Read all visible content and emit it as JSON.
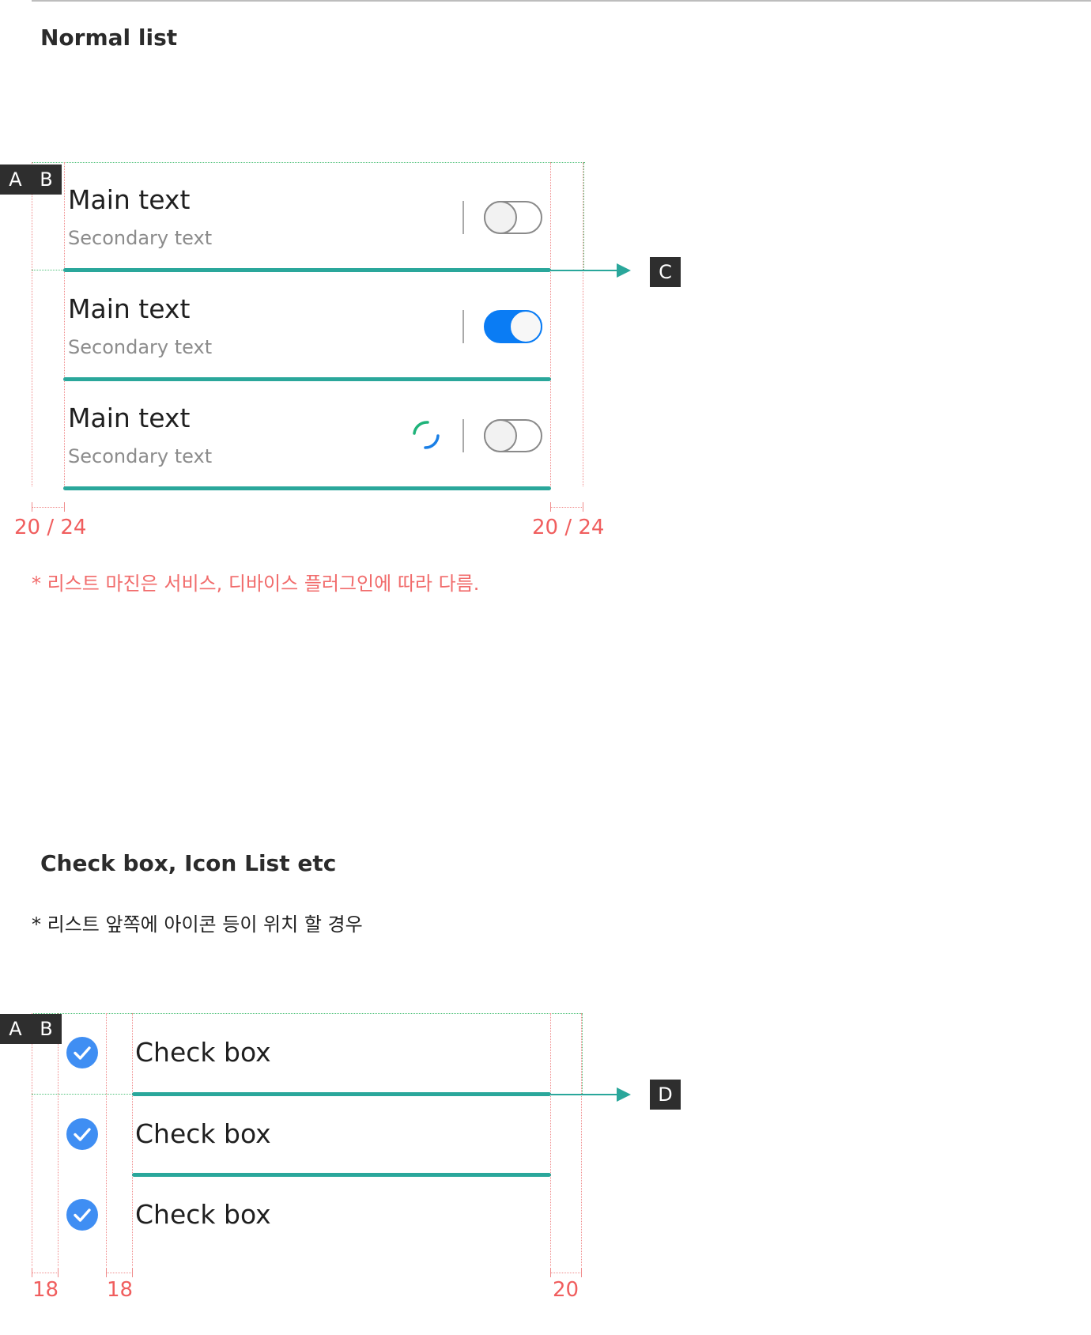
{
  "section1": {
    "title": "Normal list",
    "rows": [
      {
        "main": "Main text",
        "secondary": "Secondary text",
        "toggle": "off",
        "loading": false
      },
      {
        "main": "Main text",
        "secondary": "Secondary text",
        "toggle": "on",
        "loading": false
      },
      {
        "main": "Main text",
        "secondary": "Secondary text",
        "toggle": "off",
        "loading": true
      }
    ],
    "markers": {
      "a": "A",
      "b": "B",
      "c": "C"
    },
    "dim_left": "20 / 24",
    "dim_right": "20 / 24",
    "note": "* 리스트 마진은 서비스, 디바이스 플러그인에 따라 다름."
  },
  "section2": {
    "title": "Check box, Icon List etc",
    "note": "* 리스트 앞쪽에 아이콘 등이 위치 할 경우",
    "rows": [
      {
        "label": "Check box",
        "checked": true
      },
      {
        "label": "Check box",
        "checked": true
      },
      {
        "label": "Check box",
        "checked": true
      }
    ],
    "markers": {
      "a": "A",
      "b": "B",
      "d": "D"
    },
    "dim_1": "18",
    "dim_2": "18",
    "dim_3": "20"
  },
  "colors": {
    "divider_teal": "#2aa79b",
    "toggle_on": "#0a7cf4",
    "check_blue": "#3f8ef3",
    "dimension_red": "#f05e5e",
    "guide_green": "#52c27c"
  },
  "icons": [
    "toggle-off-icon",
    "toggle-on-icon",
    "loading-spinner-icon",
    "check-circle-icon",
    "arrow-right-icon"
  ]
}
